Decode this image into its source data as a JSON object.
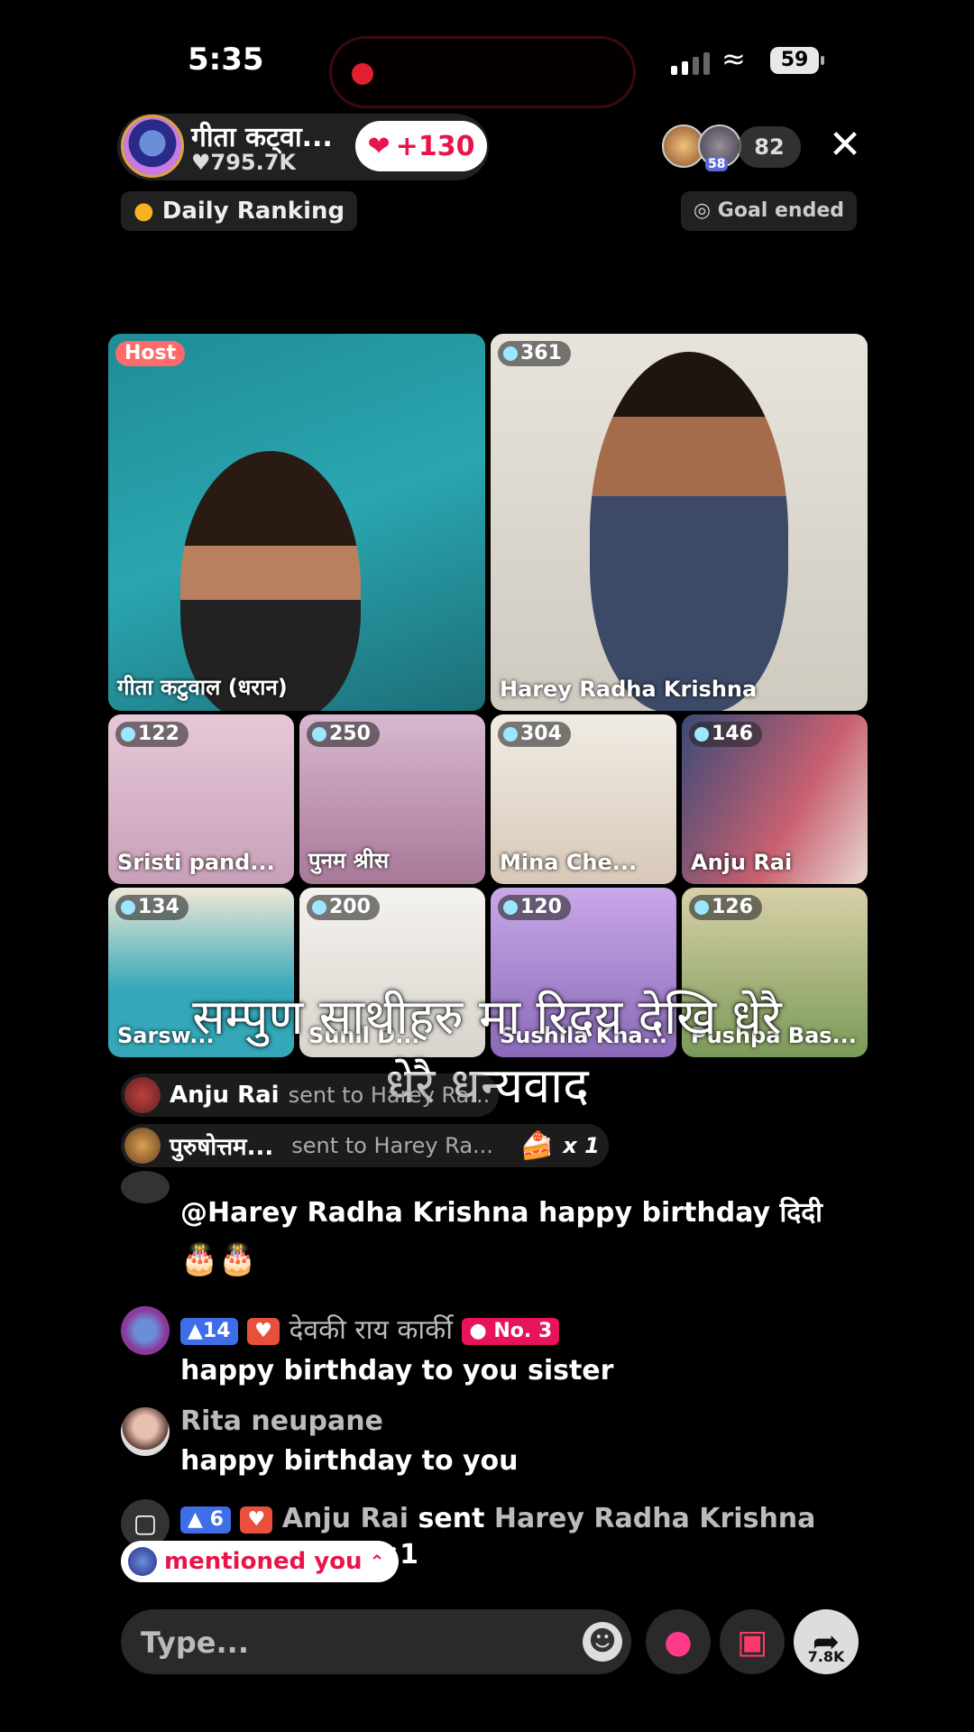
{
  "status_bar": {
    "time": "5:35",
    "battery": "59"
  },
  "host": {
    "name": "गीता कट्वा...",
    "likes": "795.7K",
    "follow_label": "+130"
  },
  "viewers": {
    "count": "82",
    "avatar_level": "58"
  },
  "pills": {
    "daily_ranking": "Daily Ranking",
    "goal": "Goal ended"
  },
  "tiles": [
    {
      "badge": "Host",
      "name": "गीता कटुवाल (धरान)"
    },
    {
      "badge": "361",
      "name": "Harey Radha Krishna"
    },
    {
      "badge": "122",
      "name": "Sristi pand..."
    },
    {
      "badge": "250",
      "name": "पुनम श्रीस"
    },
    {
      "badge": "304",
      "name": "Mina Che..."
    },
    {
      "badge": "146",
      "name": "Anju Rai"
    },
    {
      "badge": "134",
      "name": "Sarsw..."
    },
    {
      "badge": "200",
      "name": "Sunil D..."
    },
    {
      "badge": "120",
      "name": "Sushila Kha..."
    },
    {
      "badge": "126",
      "name": "Pushpa Bas..."
    }
  ],
  "caption": {
    "line1": "सम्पुण साथीहरु मा रिदय देखि धेरै",
    "line2": "धेरै धन्यवाद"
  },
  "chat": {
    "gift1": {
      "user": "Anju Rai",
      "text": "sent to Harey Ra..."
    },
    "gift2": {
      "user": "पुरुषोत्तम...",
      "text": "sent to Harey Ra...",
      "count": "x 1"
    },
    "msg1": {
      "text": "@Harey Radha Krishna happy birthday दिदी",
      "emoji": "🎂🎂"
    },
    "msg2": {
      "level": "14",
      "user": "देवकी राय कार्की",
      "rank": "No. 3",
      "text": "happy birthday to you sister"
    },
    "msg3": {
      "user": "Rita neupane",
      "text": "happy birthday to you"
    },
    "msg4": {
      "level": "6",
      "user": "Anju Rai",
      "verb": "sent",
      "target": "Harey Radha Krishna",
      "count": "×1"
    },
    "mention": "mentioned you"
  },
  "bottom": {
    "placeholder": "Type...",
    "share_count": "7.8K"
  }
}
